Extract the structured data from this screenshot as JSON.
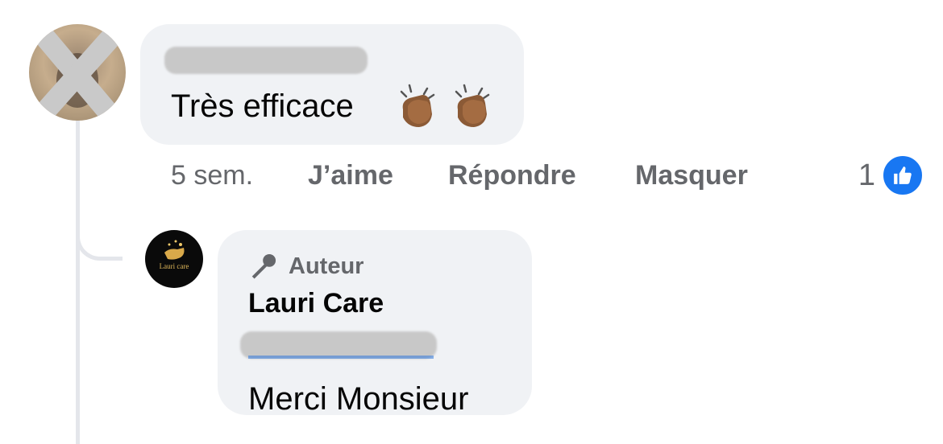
{
  "comment": {
    "author_name": "",
    "text": "Très efficace",
    "emojis": [
      "clapping-hands-emoji",
      "clapping-hands-emoji"
    ],
    "time": "5 sem.",
    "actions": {
      "like": "J’aime",
      "reply": "Répondre",
      "hide": "Masquer"
    },
    "reaction_count": "1",
    "reaction_icon": "like-icon"
  },
  "reply": {
    "badge_label": "Auteur",
    "badge_icon": "microphone-icon",
    "author_name": "Lauri Care",
    "mention": "",
    "text": "Merci Monsieur",
    "avatar_logo_text": "Lauri care"
  },
  "colors": {
    "bubble": "#f0f2f5",
    "secondary_text": "#65676b",
    "mention": "#216fdb",
    "like_blue": "#1877f2"
  }
}
